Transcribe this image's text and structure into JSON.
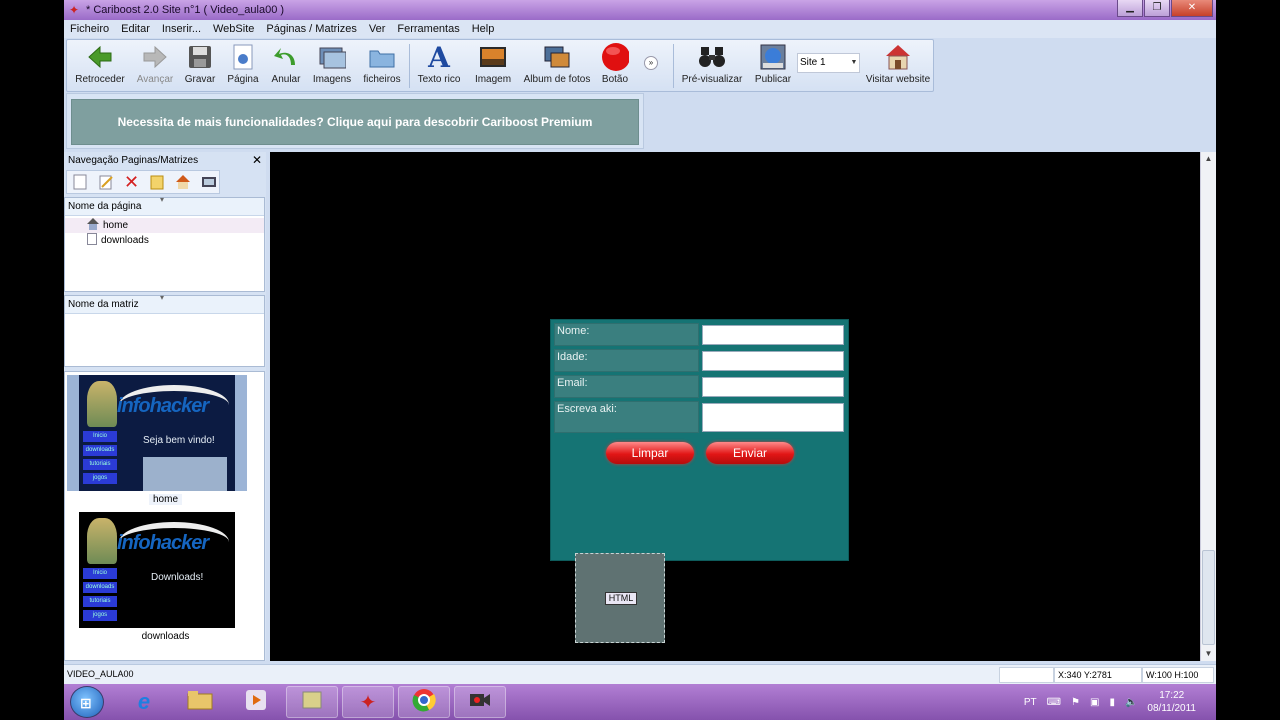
{
  "window": {
    "title": "* Cariboost 2.0  Site n°1 ( Video_aula00 )"
  },
  "menu": [
    "Ficheiro",
    "Editar",
    "Inserir...",
    "WebSite",
    "Páginas / Matrizes",
    "Ver",
    "Ferramentas",
    "Help"
  ],
  "toolbar": {
    "back": "Retroceder",
    "forward": "Avançar",
    "save": "Gravar",
    "page": "Página",
    "undo": "Anular",
    "images": "Imagens",
    "files": "ficheiros",
    "rich_text": "Texto rico",
    "image": "Imagem",
    "photo_album": "Album de fotos",
    "button": "Botão",
    "preview": "Pré-visualizar",
    "publish": "Publicar",
    "site_select": "Site 1",
    "visit": "Visitar website"
  },
  "banner": {
    "text": "Necessita de mais funcionalidades? Clique aqui para descobrir Cariboost Premium"
  },
  "nav_panel": {
    "title": "Navegação Paginas/Matrizes",
    "pages_header": "Nome da página",
    "pages": [
      "home",
      "downloads"
    ],
    "templates_header": "Nome da matriz",
    "thumbnails": [
      {
        "label": "home",
        "logo": "infohacker",
        "message": "Seja bem vindo!",
        "nav": [
          "Inicio",
          "downloads",
          "tutoriais",
          "jogos"
        ]
      },
      {
        "label": "downloads",
        "logo": "infohacker",
        "message": "Downloads!",
        "nav": [
          "Inicio",
          "downloads",
          "tutoriais",
          "jogos"
        ]
      }
    ]
  },
  "form": {
    "fields": [
      "Nome:",
      "Idade:",
      "Email:",
      "Escreva aki:"
    ],
    "clear_button": "Limpar",
    "send_button": "Enviar"
  },
  "html_block": {
    "tag": "HTML"
  },
  "status": {
    "page_name": "VIDEO_AULA00",
    "coords": "X:340 Y:2781",
    "size": "W:100 H:100"
  },
  "taskbar": {
    "language": "PT",
    "time": "17:22",
    "date": "08/11/2011"
  }
}
